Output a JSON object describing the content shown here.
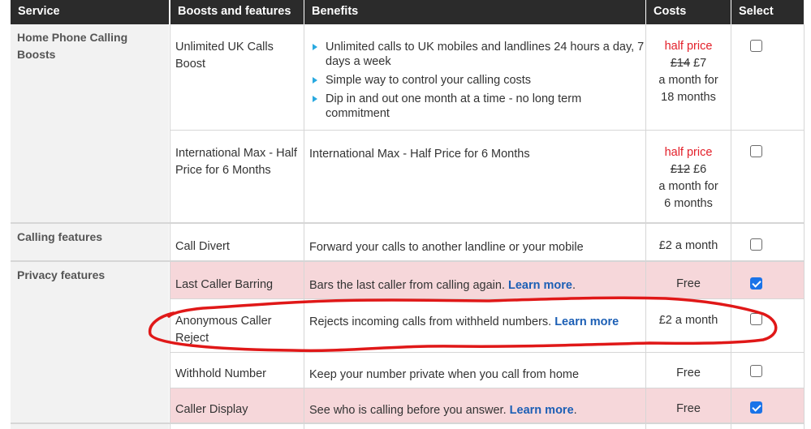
{
  "headers": {
    "service": "Service",
    "boosts": "Boosts and features",
    "benefits": "Benefits",
    "costs": "Costs",
    "select": "Select"
  },
  "services": {
    "home_phone": "Home Phone Calling Boosts",
    "calling": "Calling features",
    "privacy": "Privacy features"
  },
  "rows": [
    {
      "boost": "Unlimited UK Calls Boost",
      "benefits": [
        "Unlimited calls to UK mobiles and landlines 24 hours a day, 7 days a week",
        "Simple way to control your calling costs",
        "Dip in and out one month at a time - no long term commitment"
      ],
      "cost_tag": "half price",
      "cost_old": "£14",
      "cost_new": "£7",
      "cost_term": "a month for 18 months",
      "selected": false
    },
    {
      "boost": "International Max - Half Price for 6 Months",
      "benefit": "International Max - Half Price for 6 Months",
      "cost_tag": "half price",
      "cost_old": "£12",
      "cost_new": "£6",
      "cost_term": "a month for 6 months",
      "selected": false
    },
    {
      "boost": "Call Divert",
      "benefit": "Forward your calls to another landline or your mobile",
      "cost": "£2 a month",
      "selected": false
    },
    {
      "boost": "Last Caller Barring",
      "benefit": "Bars the last caller from calling again.",
      "link": "Learn more",
      "cost": "Free",
      "selected": true
    },
    {
      "boost": "Anonymous Caller Reject",
      "benefit": "Rejects incoming calls from withheld numbers.",
      "link": "Learn more",
      "cost": "£2 a month",
      "selected": false
    },
    {
      "boost": "Withhold Number",
      "benefit": "Keep your number private when you call from home",
      "cost": "Free",
      "selected": false
    },
    {
      "boost": "Caller Display",
      "benefit": "See who is calling before you answer.",
      "link": "Learn more",
      "cost": "Free",
      "selected": true
    }
  ],
  "colors": {
    "header_bg": "#2b2b2b",
    "service_bg": "#f2f2f2",
    "selected_row_bg": "#f6d7da",
    "half_price": "#e3202a",
    "link": "#1c5fb5",
    "bullet": "#29a9e0",
    "checkbox_checked": "#1a73e8",
    "annotation": "#e01818"
  },
  "icons": {
    "bullet": "triangle-bullet-icon",
    "checkbox": "checkbox-icon"
  }
}
